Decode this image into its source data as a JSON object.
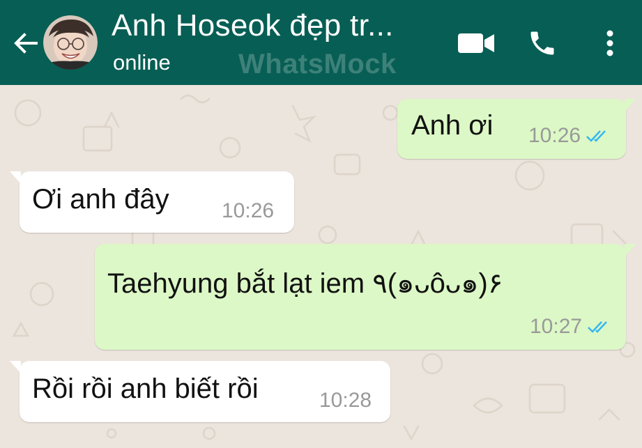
{
  "header": {
    "contact_name": "Anh Hoseok đẹp tr...",
    "status": "online",
    "watermark": "WhatsMock",
    "icons": {
      "back": "back-arrow-icon",
      "video": "video-call-icon",
      "phone": "phone-icon",
      "menu": "more-vert-icon"
    }
  },
  "colors": {
    "header_bg": "#075e54",
    "chat_bg": "#ece5dd",
    "outgoing_bubble": "#dcf8c6",
    "incoming_bubble": "#ffffff",
    "read_ticks": "#34b7f1"
  },
  "messages": [
    {
      "direction": "outgoing",
      "text": "Anh ơi",
      "time": "10:26",
      "status": "read"
    },
    {
      "direction": "incoming",
      "text": "Ơi anh đây",
      "time": "10:26"
    },
    {
      "direction": "outgoing",
      "text": "Taehyung bắt lạt iem ٩(๑ᴗôᴗ๑)۶",
      "time": "10:27",
      "status": "read"
    },
    {
      "direction": "incoming",
      "text": "Rồi rồi anh biết rồi",
      "time": "10:28"
    }
  ]
}
